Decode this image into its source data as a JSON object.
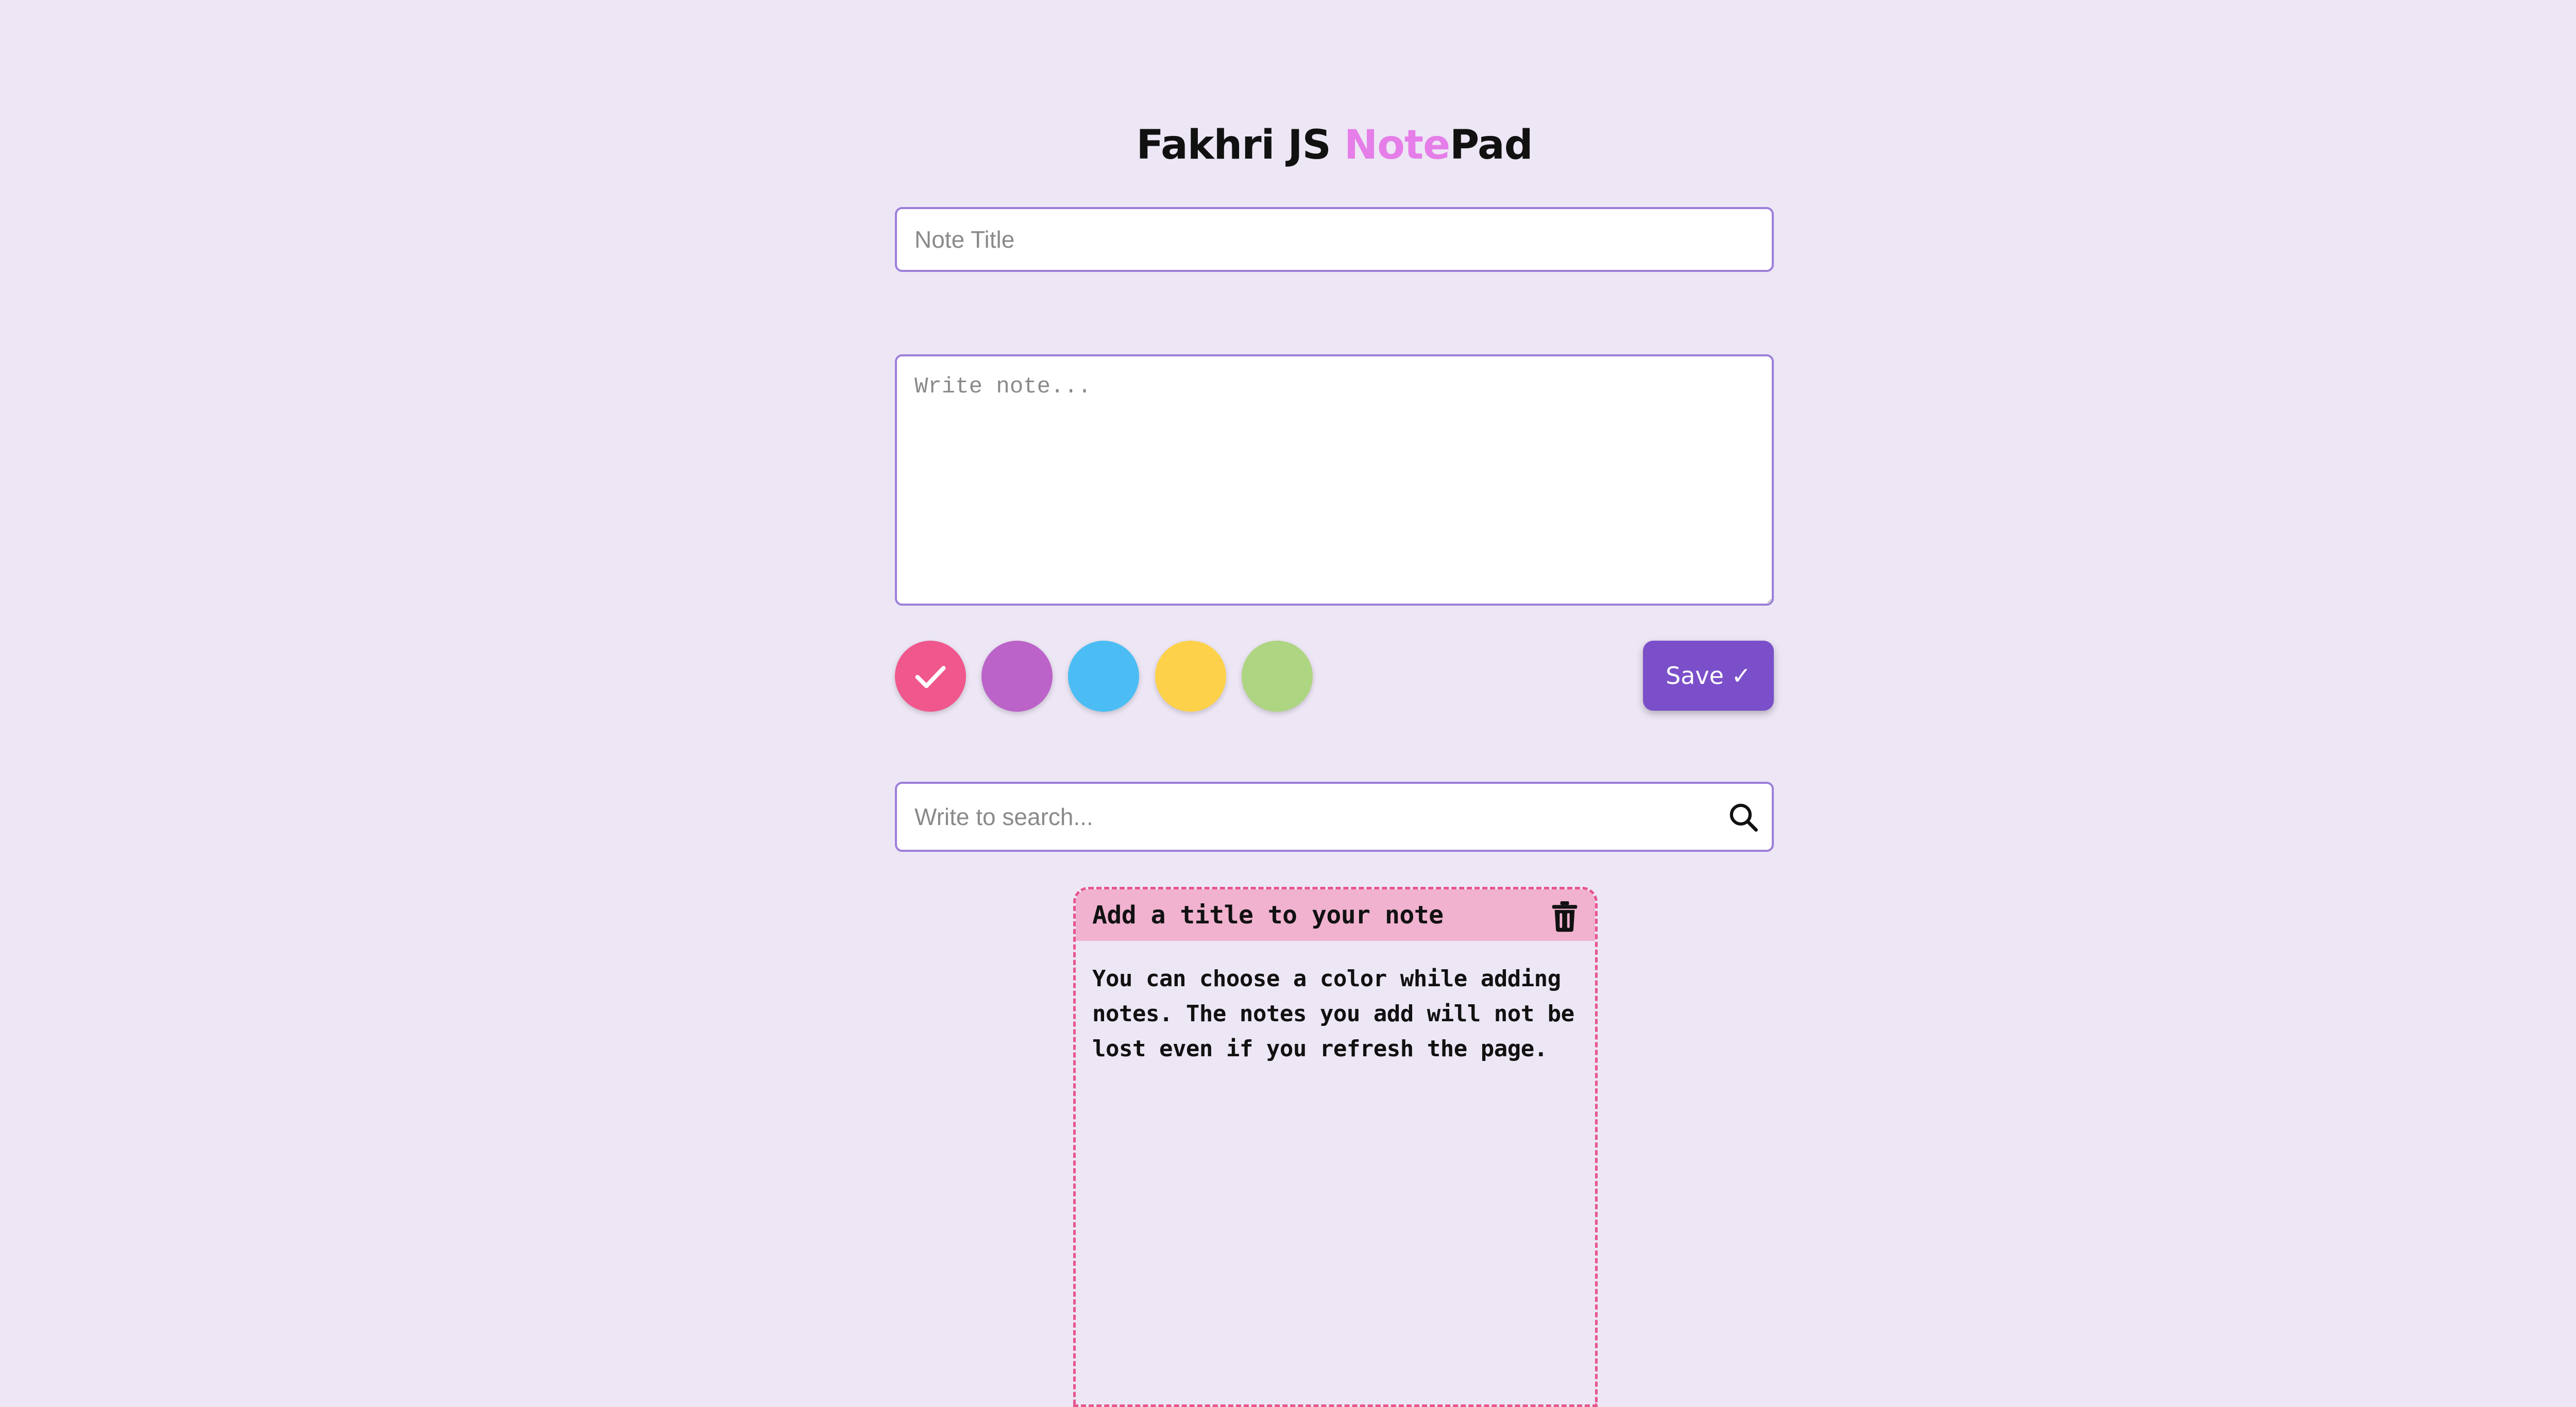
{
  "header": {
    "title_part1": "Fakhri JS ",
    "title_accent": "Note",
    "title_part2": "Pad"
  },
  "form": {
    "title_placeholder": "Note Title",
    "title_value": "",
    "body_placeholder": "Write note...",
    "body_value": "",
    "save_label": "Save ✓"
  },
  "colors": {
    "swatches": [
      {
        "name": "pink",
        "hex": "#f0578c",
        "selected": true
      },
      {
        "name": "purple",
        "hex": "#bb63c9",
        "selected": false
      },
      {
        "name": "blue",
        "hex": "#4bbdf4",
        "selected": false
      },
      {
        "name": "yellow",
        "hex": "#fdd24a",
        "selected": false
      },
      {
        "name": "green",
        "hex": "#aed581",
        "selected": false
      }
    ],
    "accent": "#7b4fc9",
    "border": "#9c7ed9",
    "background": "#ede6f5"
  },
  "search": {
    "placeholder": "Write to search...",
    "value": ""
  },
  "notes": [
    {
      "title": "Add a title to your note",
      "text": "You can choose a color while adding notes. The notes you add will not be lost even if you refresh the page.",
      "color": "#f0b2cf",
      "border_color": "#e8568e"
    }
  ],
  "icons": {
    "check": "check-icon",
    "search": "search-icon",
    "trash": "trash-icon"
  }
}
